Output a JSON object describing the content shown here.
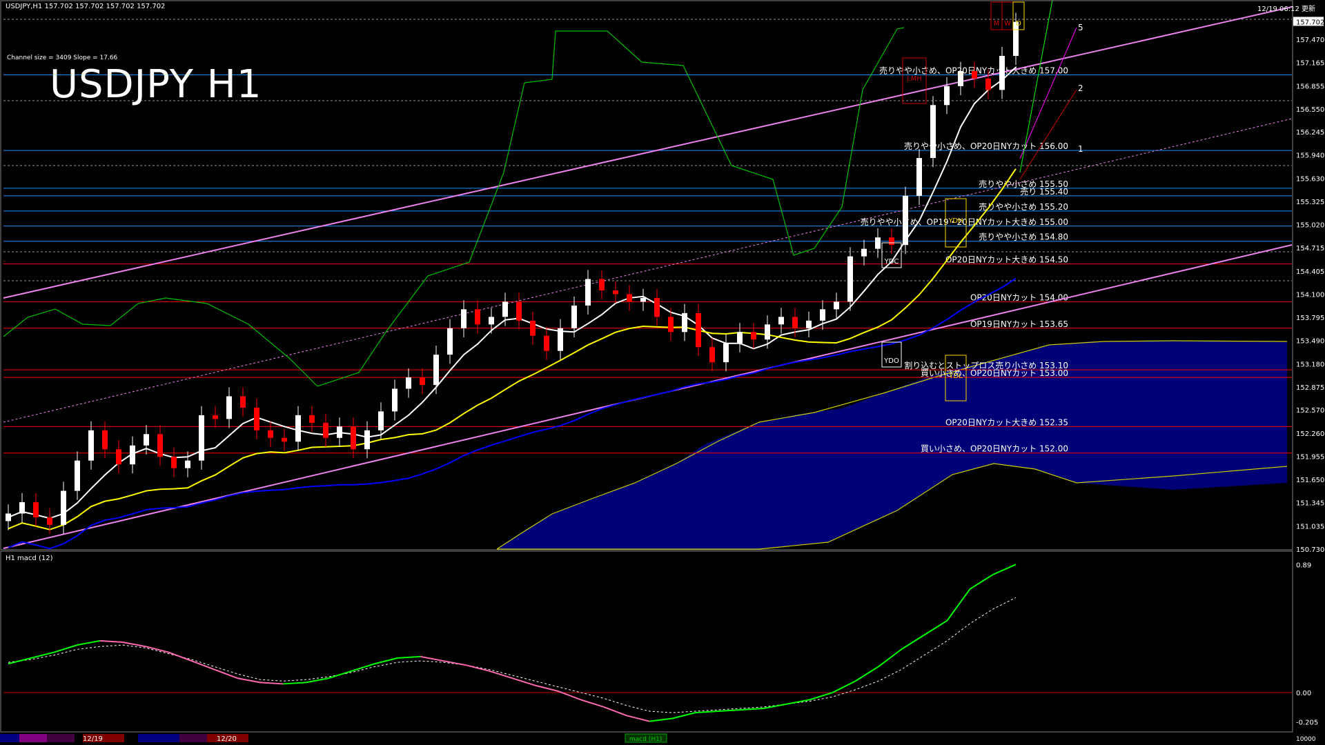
{
  "header": {
    "symbol_line": "USDJPY,H1  157.702 157.702 157.702 157.702",
    "channel_info": "Channel size = 3409 Slope = 17.66",
    "title": "USDJPY H1",
    "updated": "12/19 06:12 更新",
    "macd_label": "H1  macd (12)"
  },
  "colors": {
    "background": "#000000",
    "bull_candle": "#ffffff",
    "bear_candle": "#ff0000",
    "sma_short": "#ffffff",
    "sma_mid": "#ffff00",
    "sma_long": "#0000ff",
    "channel": "#ee82ee",
    "level_line_blue": "#1e90ff",
    "level_line_red": "#ff0000",
    "cloud": "#00008b",
    "macd_up": "#00ff00",
    "macd_down": "#ff69b4"
  },
  "chart_data": {
    "type": "line",
    "price_axis_ticks": [
      "157.702",
      "157.470",
      "157.165",
      "156.855",
      "156.550",
      "156.245",
      "155.940",
      "155.630",
      "155.325",
      "155.020",
      "154.715",
      "154.405",
      "154.100",
      "153.795",
      "153.490",
      "153.180",
      "152.875",
      "152.570",
      "152.260",
      "151.955",
      "151.650",
      "151.345",
      "151.035",
      "150.730"
    ],
    "ylim": [
      150.73,
      157.77
    ],
    "current_price": "157.702",
    "levels": [
      {
        "price": 157.0,
        "label": "売りやや小さめ、OP20日NYカット大きめ 157.00",
        "color": "blue"
      },
      {
        "price": 156.0,
        "label": "売りやや小さめ、OP20日NYカット 156.00",
        "color": "blue"
      },
      {
        "price": 155.5,
        "label": "売りやや小さめ 155.50",
        "color": "blue"
      },
      {
        "price": 155.4,
        "label": "売り 155.40",
        "color": "blue"
      },
      {
        "price": 155.2,
        "label": "売りやや小さめ 155.20",
        "color": "blue"
      },
      {
        "price": 155.0,
        "label": "売りやや小さめ、OP19・20日NYカット大きめ 155.00",
        "color": "blue"
      },
      {
        "price": 154.8,
        "label": "売りやや小さめ 154.80",
        "color": "blue"
      },
      {
        "price": 154.5,
        "label": "OP20日NYカット大きめ 154.50",
        "color": "red"
      },
      {
        "price": 154.0,
        "label": "OP20日NYカット 154.00",
        "color": "red"
      },
      {
        "price": 153.65,
        "label": "OP19日NYカット 153.65",
        "color": "red"
      },
      {
        "price": 153.1,
        "label": "割り込むとストップロス売り小さめ 153.10",
        "color": "red"
      },
      {
        "price": 153.0,
        "label": "買い小さめ、OP20日NYカット 153.00",
        "color": "red"
      },
      {
        "price": 152.35,
        "label": "OP20日NYカット大きめ 152.35",
        "color": "red"
      },
      {
        "price": 152.0,
        "label": "買い小さめ、OP20日NYカット 152.00",
        "color": "red"
      }
    ],
    "fib_labels": [
      "5",
      "2",
      "1"
    ],
    "day_markers": [
      "YDC",
      "YDO",
      "YDH",
      "YDL",
      "LMH",
      "M",
      "W",
      "D"
    ],
    "close_path": [
      151.2,
      151.35,
      151.15,
      151.05,
      151.5,
      151.9,
      152.3,
      152.05,
      151.85,
      152.1,
      152.25,
      151.95,
      151.8,
      151.9,
      152.5,
      152.45,
      152.75,
      152.6,
      152.3,
      152.2,
      152.15,
      152.5,
      152.4,
      152.2,
      152.35,
      152.05,
      152.3,
      152.55,
      152.85,
      153.0,
      152.9,
      153.3,
      153.65,
      153.9,
      153.7,
      153.8,
      154.0,
      153.75,
      153.55,
      153.35,
      153.65,
      153.95,
      154.3,
      154.15,
      154.1,
      154.0,
      154.05,
      153.8,
      153.6,
      153.85,
      153.4,
      153.2,
      153.45,
      153.6,
      153.5,
      153.7,
      153.8,
      153.65,
      153.75,
      153.9,
      154.0,
      154.6,
      154.7,
      154.85,
      154.75,
      155.4,
      155.9,
      156.6,
      156.85,
      157.05,
      156.95,
      156.8,
      157.25,
      157.7
    ],
    "macd": {
      "zero_label": "0.00",
      "ticks": [
        "0.89",
        "0.00",
        "-0.205"
      ],
      "ylim": [
        -0.24,
        0.93
      ],
      "main": [
        0.2,
        0.24,
        0.28,
        0.33,
        0.36,
        0.35,
        0.32,
        0.28,
        0.22,
        0.16,
        0.1,
        0.07,
        0.06,
        0.07,
        0.1,
        0.15,
        0.2,
        0.24,
        0.25,
        0.22,
        0.19,
        0.15,
        0.1,
        0.05,
        0.01,
        -0.05,
        -0.1,
        -0.16,
        -0.2,
        -0.18,
        -0.14,
        -0.13,
        -0.12,
        -0.11,
        -0.08,
        -0.05,
        0.0,
        0.08,
        0.18,
        0.3,
        0.4,
        0.5,
        0.72,
        0.82,
        0.89
      ],
      "signal": [
        0.21,
        0.23,
        0.26,
        0.3,
        0.32,
        0.33,
        0.31,
        0.27,
        0.23,
        0.18,
        0.13,
        0.09,
        0.08,
        0.09,
        0.11,
        0.14,
        0.18,
        0.21,
        0.22,
        0.21,
        0.19,
        0.16,
        0.12,
        0.08,
        0.04,
        0.0,
        -0.04,
        -0.09,
        -0.13,
        -0.14,
        -0.13,
        -0.12,
        -0.11,
        -0.1,
        -0.08,
        -0.06,
        -0.03,
        0.02,
        0.08,
        0.16,
        0.26,
        0.36,
        0.48,
        0.58,
        0.66
      ]
    }
  },
  "footer": {
    "date1": "12/19",
    "date2": "12/20",
    "tab": "macd (H1)",
    "count": "10000"
  }
}
